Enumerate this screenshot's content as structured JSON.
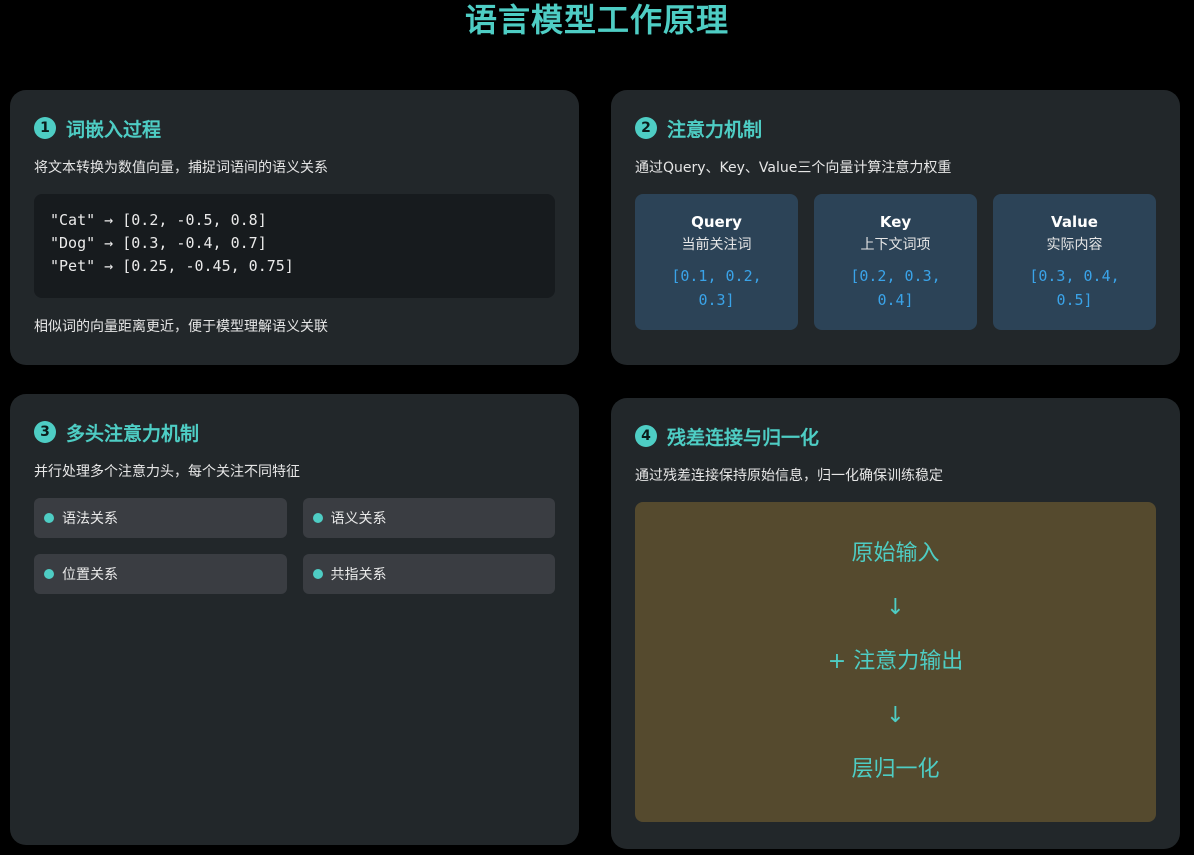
{
  "page_title": "语言模型工作原理",
  "colors": {
    "accent": "#4ecdc4",
    "card_bg": "#22272a",
    "vector_blue": "#3aa3e8",
    "flow_bg": "#554a2e"
  },
  "cards": [
    {
      "number": "1",
      "title": "词嵌入过程",
      "desc": "将文本转换为数值向量，捕捉词语间的语义关系",
      "code_lines": [
        "\"Cat\" → [0.2, -0.5, 0.8]",
        "\"Dog\" → [0.3, -0.4, 0.7]",
        "\"Pet\" → [0.25, -0.45, 0.75]"
      ],
      "note": "相似词的向量距离更近，便于模型理解语义关联"
    },
    {
      "number": "2",
      "title": "注意力机制",
      "desc": "通过Query、Key、Value三个向量计算注意力权重",
      "boxes": [
        {
          "name": "Query",
          "sub": "当前关注词",
          "vector": "[0.1, 0.2, 0.3]"
        },
        {
          "name": "Key",
          "sub": "上下文词项",
          "vector": "[0.2, 0.3, 0.4]"
        },
        {
          "name": "Value",
          "sub": "实际内容",
          "vector": "[0.3, 0.4, 0.5]"
        }
      ]
    },
    {
      "number": "3",
      "title": "多头注意力机制",
      "desc": "并行处理多个注意力头，每个关注不同特征",
      "heads": [
        "语法关系",
        "语义关系",
        "位置关系",
        "共指关系"
      ]
    },
    {
      "number": "4",
      "title": "残差连接与归一化",
      "desc": "通过残差连接保持原始信息，归一化确保训练稳定",
      "flow": [
        "原始输入",
        "↓",
        "+ 注意力输出",
        "↓",
        "层归一化"
      ]
    }
  ]
}
